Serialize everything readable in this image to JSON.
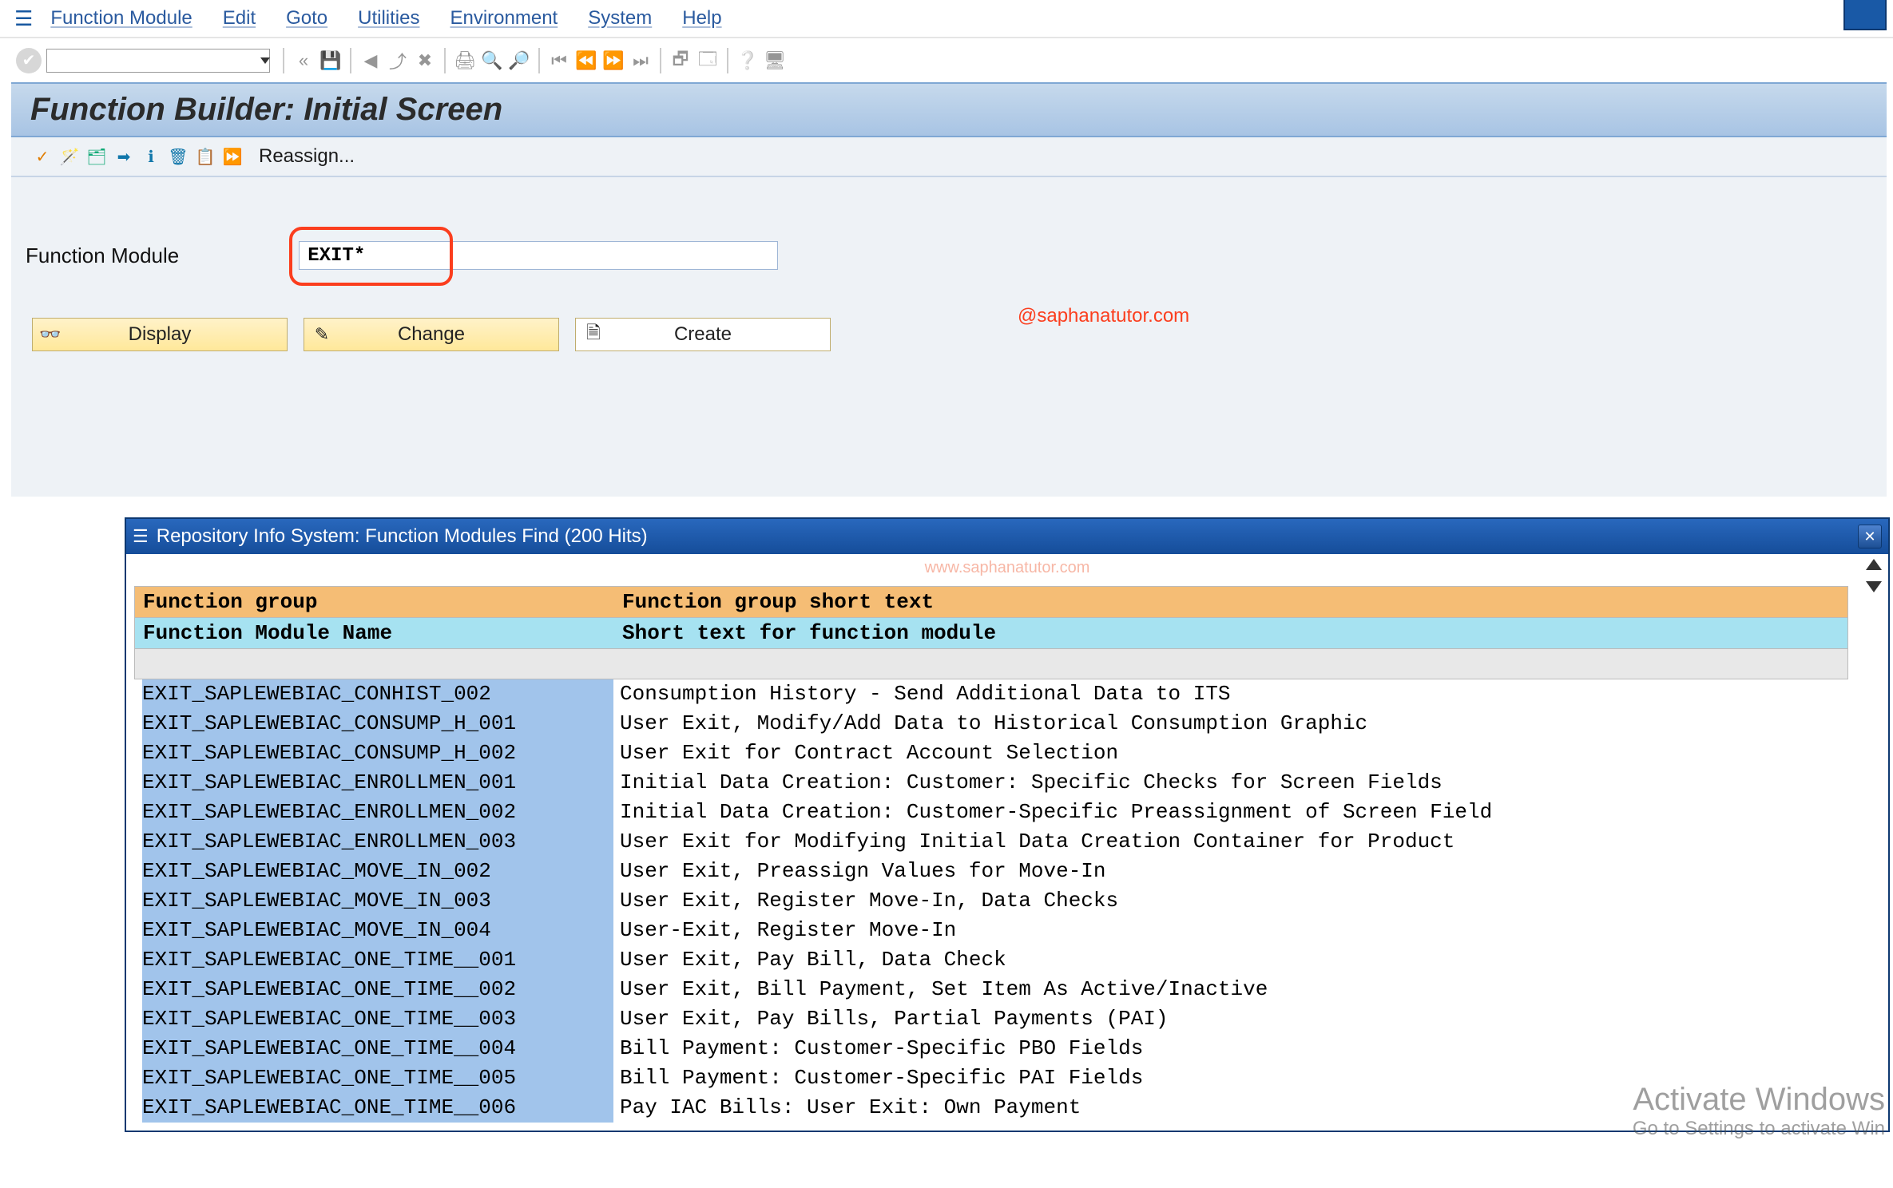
{
  "menu": {
    "items": [
      "Function Module",
      "Edit",
      "Goto",
      "Utilities",
      "Environment",
      "System",
      "Help"
    ]
  },
  "title": "Function Builder: Initial Screen",
  "app_toolbar": {
    "reassign_label": "Reassign..."
  },
  "field": {
    "label": "Function Module",
    "value": "EXIT*"
  },
  "annotation": "@saphanatutor.com",
  "buttons": {
    "display": "Display",
    "change": "Change",
    "create": "Create"
  },
  "popup": {
    "title": "Repository Info System: Function Modules Find (200 Hits)",
    "watermark": "www.saphanatutor.com",
    "headers": {
      "group": "Function group",
      "group_text": "Function group short text",
      "module_name": "Function Module Name",
      "module_text": "Short text for function module"
    },
    "rows": [
      {
        "name": "EXIT_SAPLEWEBIAC_CONHIST_002  ",
        "desc": "Consumption History - Send Additional Data to ITS"
      },
      {
        "name": "EXIT_SAPLEWEBIAC_CONSUMP_H_001",
        "desc": "User Exit, Modify/Add Data to Historical Consumption Graphic"
      },
      {
        "name": "EXIT_SAPLEWEBIAC_CONSUMP_H_002",
        "desc": "User Exit for Contract Account Selection"
      },
      {
        "name": "EXIT_SAPLEWEBIAC_ENROLLMEN_001",
        "desc": "Initial Data Creation: Customer: Specific Checks for Screen Fields"
      },
      {
        "name": "EXIT_SAPLEWEBIAC_ENROLLMEN_002",
        "desc": "Initial Data Creation: Customer-Specific Preassignment of Screen Field"
      },
      {
        "name": "EXIT_SAPLEWEBIAC_ENROLLMEN_003",
        "desc": "User Exit for Modifying Initial Data Creation Container for Product"
      },
      {
        "name": "EXIT_SAPLEWEBIAC_MOVE_IN_002  ",
        "desc": "User Exit, Preassign Values for Move-In"
      },
      {
        "name": "EXIT_SAPLEWEBIAC_MOVE_IN_003  ",
        "desc": "User Exit, Register Move-In, Data Checks"
      },
      {
        "name": "EXIT_SAPLEWEBIAC_MOVE_IN_004  ",
        "desc": "User-Exit, Register Move-In"
      },
      {
        "name": "EXIT_SAPLEWEBIAC_ONE_TIME__001",
        "desc": "User Exit, Pay Bill, Data Check"
      },
      {
        "name": "EXIT_SAPLEWEBIAC_ONE_TIME__002",
        "desc": "User Exit, Bill Payment, Set Item As Active/Inactive"
      },
      {
        "name": "EXIT_SAPLEWEBIAC_ONE_TIME__003",
        "desc": "User Exit, Pay Bills, Partial Payments (PAI)"
      },
      {
        "name": "EXIT_SAPLEWEBIAC_ONE_TIME__004",
        "desc": "Bill Payment: Customer-Specific PBO Fields"
      },
      {
        "name": "EXIT_SAPLEWEBIAC_ONE_TIME__005",
        "desc": "Bill Payment: Customer-Specific PAI Fields"
      },
      {
        "name": "EXIT_SAPLEWEBIAC_ONE_TIME__006",
        "desc": "Pay IAC Bills: User Exit: Own Payment"
      }
    ]
  },
  "overlay": {
    "line1": "Activate Windows",
    "line2": "Go to Settings to activate Win"
  }
}
